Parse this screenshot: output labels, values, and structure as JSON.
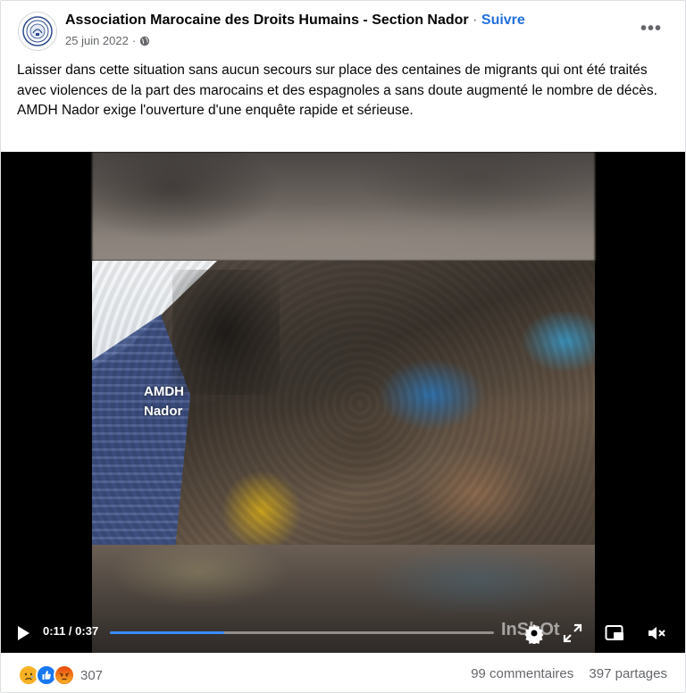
{
  "header": {
    "page_name": "Association Marocaine des Droits Humains - Section Nador",
    "separator": "·",
    "follow_label": "Suivre",
    "date": "25 juin 2022",
    "date_separator": "·",
    "privacy_icon": "globe-icon",
    "more_icon": "more-options-icon"
  },
  "message": {
    "paragraph_1": "Laisser dans cette situation sans aucun secours sur place des centaines de migrants qui ont été traités avec violences de la part des marocains et des espagnoles a sans doute augmenté le nombre de décès.",
    "paragraph_2": "AMDH Nador exige l'ouverture d'une enquête rapide et sérieuse."
  },
  "video": {
    "watermark_line_1": "AMDH",
    "watermark_line_2": "Nador",
    "current_time": "0:11",
    "duration": "0:37",
    "time_separator": " / ",
    "progress_fraction": 0.297,
    "overlay_logo": "InShOt",
    "controls": [
      "play-icon",
      "settings-icon",
      "fullscreen-icon",
      "picture-in-picture-icon",
      "mute-icon"
    ],
    "progress_color": "#3b8cff"
  },
  "footer": {
    "reaction_icons": [
      "sad-reaction-icon",
      "like-reaction-icon",
      "angry-reaction-icon"
    ],
    "reaction_count": "307",
    "comments": "99 commentaires",
    "shares": "397 partages"
  },
  "colors": {
    "link_blue": "#216fdb",
    "secondary_text": "#65676b",
    "like_blue": "#1877f2",
    "sad_yellow": "#f7b125",
    "angry_orange": "#e9710f"
  }
}
